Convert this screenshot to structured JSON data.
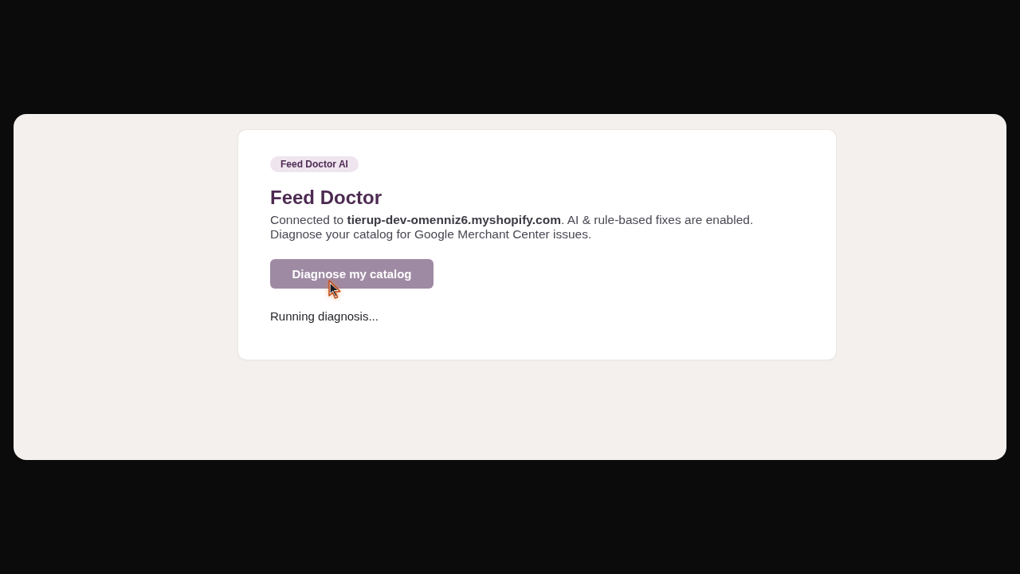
{
  "badge": "Feed Doctor AI",
  "title": "Feed Doctor",
  "description": "Connected to **tierup-dev-omenniz6.myshopify.com**. AI & rule-based fixes are enabled. Diagnose your catalog for Google Merchant Center issues.",
  "button": {
    "label": "Diagnose my catalog",
    "disabled": true
  },
  "status": "Running diagnosis..."
}
